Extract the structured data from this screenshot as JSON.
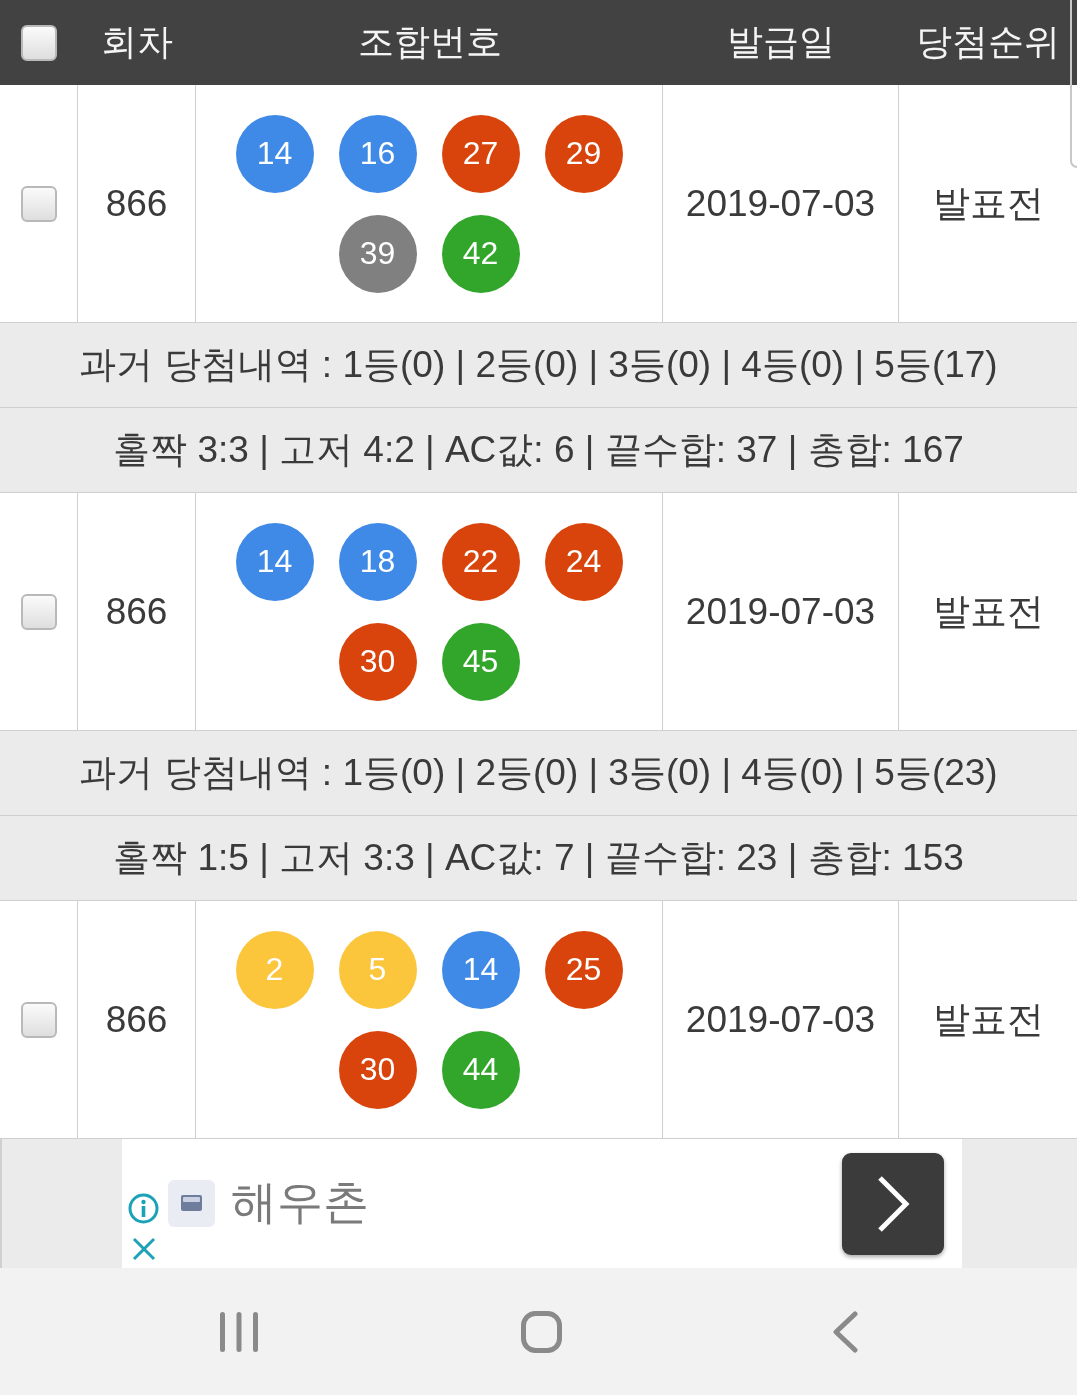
{
  "table": {
    "header": {
      "checked": false,
      "columns": [
        "회차",
        "조합번호",
        "발급일",
        "당첨순위"
      ]
    },
    "entries": [
      {
        "checked": false,
        "round": "866",
        "balls": [
          {
            "number": "14",
            "color": "#3f8ae6"
          },
          {
            "number": "16",
            "color": "#3f8ae6"
          },
          {
            "number": "27",
            "color": "#d8440c"
          },
          {
            "number": "29",
            "color": "#d8440c"
          },
          {
            "number": "39",
            "color": "#808080"
          },
          {
            "number": "42",
            "color": "#31a62b"
          }
        ],
        "date": "2019-07-03",
        "rank": "발표전",
        "history": "과거 당첨내역 : 1등(0) | 2등(0) | 3등(0) | 4등(0) | 5등(17)",
        "stats": "홀짝 3:3 | 고저 4:2 | AC값: 6 | 끝수합: 37 | 총합: 167"
      },
      {
        "checked": false,
        "round": "866",
        "balls": [
          {
            "number": "14",
            "color": "#3f8ae6"
          },
          {
            "number": "18",
            "color": "#3f8ae6"
          },
          {
            "number": "22",
            "color": "#d8440c"
          },
          {
            "number": "24",
            "color": "#d8440c"
          },
          {
            "number": "30",
            "color": "#d8440c"
          },
          {
            "number": "45",
            "color": "#31a62b"
          }
        ],
        "date": "2019-07-03",
        "rank": "발표전",
        "history": "과거 당첨내역 : 1등(0) | 2등(0) | 3등(0) | 4등(0) | 5등(23)",
        "stats": "홀짝 1:5 | 고저 3:3 | AC값: 7 | 끝수합: 23 | 총합: 153"
      },
      {
        "checked": false,
        "round": "866",
        "balls": [
          {
            "number": "2",
            "color": "#fbc53c"
          },
          {
            "number": "5",
            "color": "#fbc53c"
          },
          {
            "number": "14",
            "color": "#3f8ae6"
          },
          {
            "number": "25",
            "color": "#d8440c"
          },
          {
            "number": "30",
            "color": "#d8440c"
          },
          {
            "number": "44",
            "color": "#31a62b"
          }
        ],
        "date": "2019-07-03",
        "rank": "발표전"
      }
    ]
  },
  "ad": {
    "title": "해우촌"
  }
}
